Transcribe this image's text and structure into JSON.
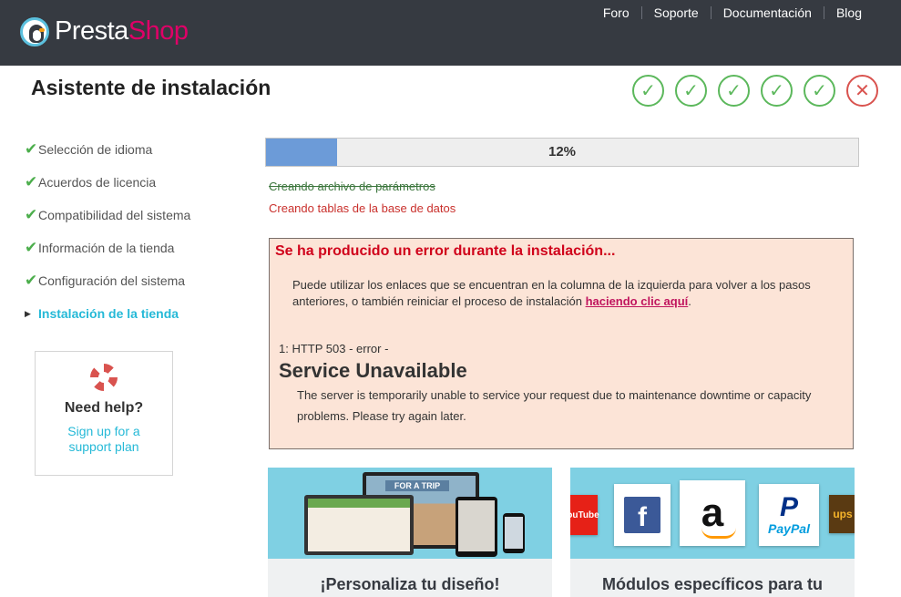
{
  "brand": {
    "logo_part1": "Presta",
    "logo_part2": "Shop"
  },
  "topnav": {
    "items": [
      "Foro",
      "Soporte",
      "Documentación",
      "Blog"
    ]
  },
  "page_title": "Asistente de instalación",
  "steps": [
    {
      "status": "done",
      "symbol": "✓"
    },
    {
      "status": "done",
      "symbol": "✓"
    },
    {
      "status": "done",
      "symbol": "✓"
    },
    {
      "status": "done",
      "symbol": "✓"
    },
    {
      "status": "done",
      "symbol": "✓"
    },
    {
      "status": "error",
      "symbol": "✕"
    }
  ],
  "sidebar": {
    "items": [
      {
        "label": "Selección de idioma",
        "state": "done"
      },
      {
        "label": "Acuerdos de licencia",
        "state": "done"
      },
      {
        "label": "Compatibilidad del sistema",
        "state": "done"
      },
      {
        "label": "Información de la tienda",
        "state": "done"
      },
      {
        "label": "Configuración del sistema",
        "state": "done"
      },
      {
        "label": "Instalación de la tienda",
        "state": "active"
      }
    ],
    "check_symbol": "✔",
    "active_symbol": "▶"
  },
  "help": {
    "icon": "lifebuoy-icon",
    "title": "Need help?",
    "link_line1": "Sign up for a",
    "link_line2": "support plan"
  },
  "progress": {
    "percent": 12,
    "label": "12%"
  },
  "log": {
    "done_line": "Creando archivo de parámetros",
    "current_line": "Creando tablas de la base de datos"
  },
  "error": {
    "title": "Se ha producido un error durante la instalación...",
    "message_before": "Puede utilizar los enlaces que se encuentran en la columna de la izquierda para volver a los pasos anteriores, o también reiniciar el proceso de instalación ",
    "message_link": "haciendo clic aquí",
    "message_after": ".",
    "code": "1: HTTP 503 - error -",
    "heading": "Service Unavailable",
    "description": "The server is temporarily unable to service your request due to maintenance downtime or capacity problems. Please try again later."
  },
  "promos": [
    {
      "caption": "¡Personaliza tu diseño!",
      "mockup_text": "FOR A TRIP"
    },
    {
      "caption": "Módulos específicos para tu",
      "logos": [
        "YouTube",
        "f",
        "a",
        "P",
        "PayPal",
        "ups"
      ]
    }
  ],
  "colors": {
    "topbar": "#363a41",
    "accent": "#25b9d7",
    "brand_pink": "#df0067",
    "success": "#5cb85c",
    "danger": "#d9534f",
    "error_bg": "#fce4d7"
  }
}
